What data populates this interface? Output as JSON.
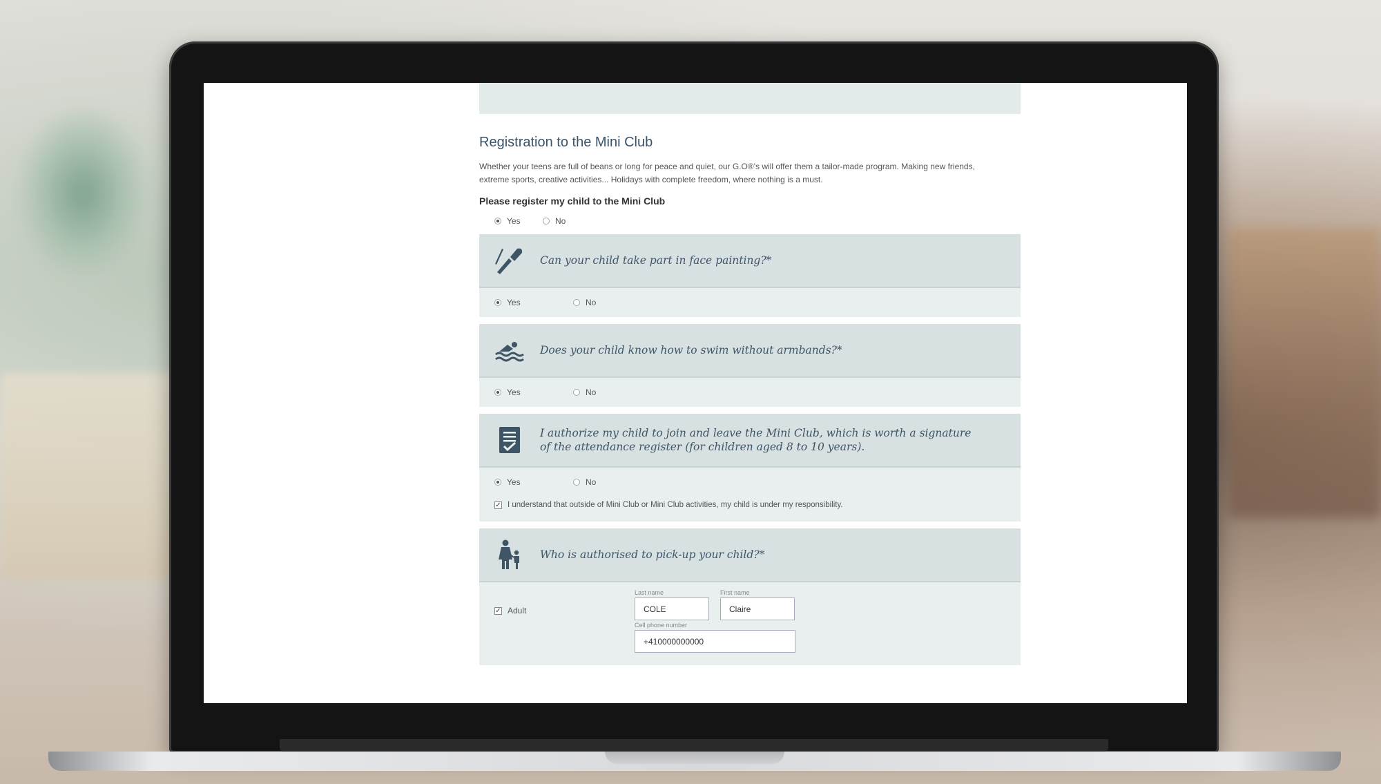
{
  "form": {
    "title": "Registration to the Mini Club",
    "intro_line1": "Whether your teens are full of beans or long for peace and quiet, our G.O®'s will offer them a tailor-made program. Making new friends,",
    "intro_line2": "extreme sports, creative activities... Holidays with complete freedom, where nothing is a must.",
    "register_label": "Please register my child to the Mini Club",
    "register_yes": "Yes",
    "register_no": "No",
    "register_selected": "Yes"
  },
  "questions": [
    {
      "icon": "face-paint-brush-icon",
      "text": "Can your child take part in face painting?*",
      "yes": "Yes",
      "no": "No",
      "selected": "Yes"
    },
    {
      "icon": "swimmer-icon",
      "text": "Does your child know how to swim without armbands?*",
      "yes": "Yes",
      "no": "No",
      "selected": "Yes"
    },
    {
      "icon": "checklist-icon",
      "text_line1": "I authorize my child to join and leave the Mini Club, which is worth a signature",
      "text_line2": "of the attendance register (for children aged 8 to 10 years).",
      "yes": "Yes",
      "no": "No",
      "selected": "Yes",
      "responsibility_text": "I understand that outside of Mini Club or Mini Club activities, my child is under my responsibility.",
      "responsibility_checked": true
    },
    {
      "icon": "parent-child-icon",
      "text": "Who is authorised to pick-up your child?*",
      "adult_label": "Adult",
      "adult_checked": true,
      "last_name_label": "Last name",
      "last_name_value": "COLE",
      "first_name_label": "First name",
      "first_name_value": "Claire",
      "phone_label": "Cell phone number",
      "phone_value": "+410000000000"
    }
  ],
  "colors": {
    "question_header_bg": "#d7e1e2",
    "question_body_bg": "#e9efef",
    "title_color": "#3a5368"
  }
}
